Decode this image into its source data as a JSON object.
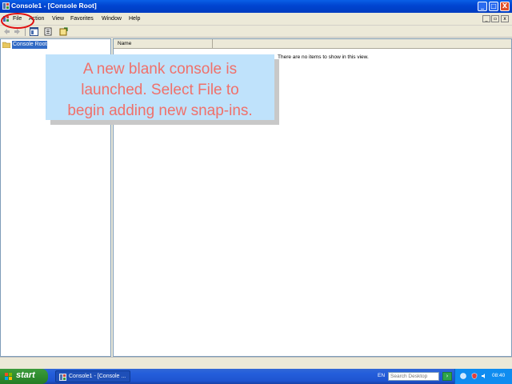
{
  "window": {
    "title": "Console1 - [Console Root]",
    "buttons": {
      "minimize": "_",
      "maximize": "□",
      "close": "X"
    }
  },
  "menubar": {
    "items": [
      "File",
      "Action",
      "View",
      "Favorites",
      "Window",
      "Help"
    ],
    "mdi_buttons": {
      "minimize": "_",
      "restore": "▫",
      "close": "x"
    }
  },
  "toolbar": {
    "icons": [
      "back-icon",
      "forward-icon",
      "show-hide-tree-icon",
      "export-list-icon",
      "help-icon"
    ]
  },
  "tree": {
    "root_label": "Console Root",
    "icon": "folder-icon"
  },
  "list": {
    "column_header": "Name",
    "empty_message": "There are no items to show in this view."
  },
  "callout": {
    "text": "A new blank console is\nlaunched. Select File to\nbegin adding new snap-ins."
  },
  "taskbar": {
    "start_label": "start",
    "task_label": "Console1 - [Console ...",
    "language": "EN",
    "search_placeholder": "Search Desktop",
    "search_go": "›",
    "clock": "08:40"
  },
  "colors": {
    "titlebar": "#0044d0",
    "callout_bg": "#bfe2fb",
    "callout_text": "#f0706a",
    "highlight": "#e01010",
    "selection": "#316ac5",
    "start": "#2f8d2f"
  }
}
